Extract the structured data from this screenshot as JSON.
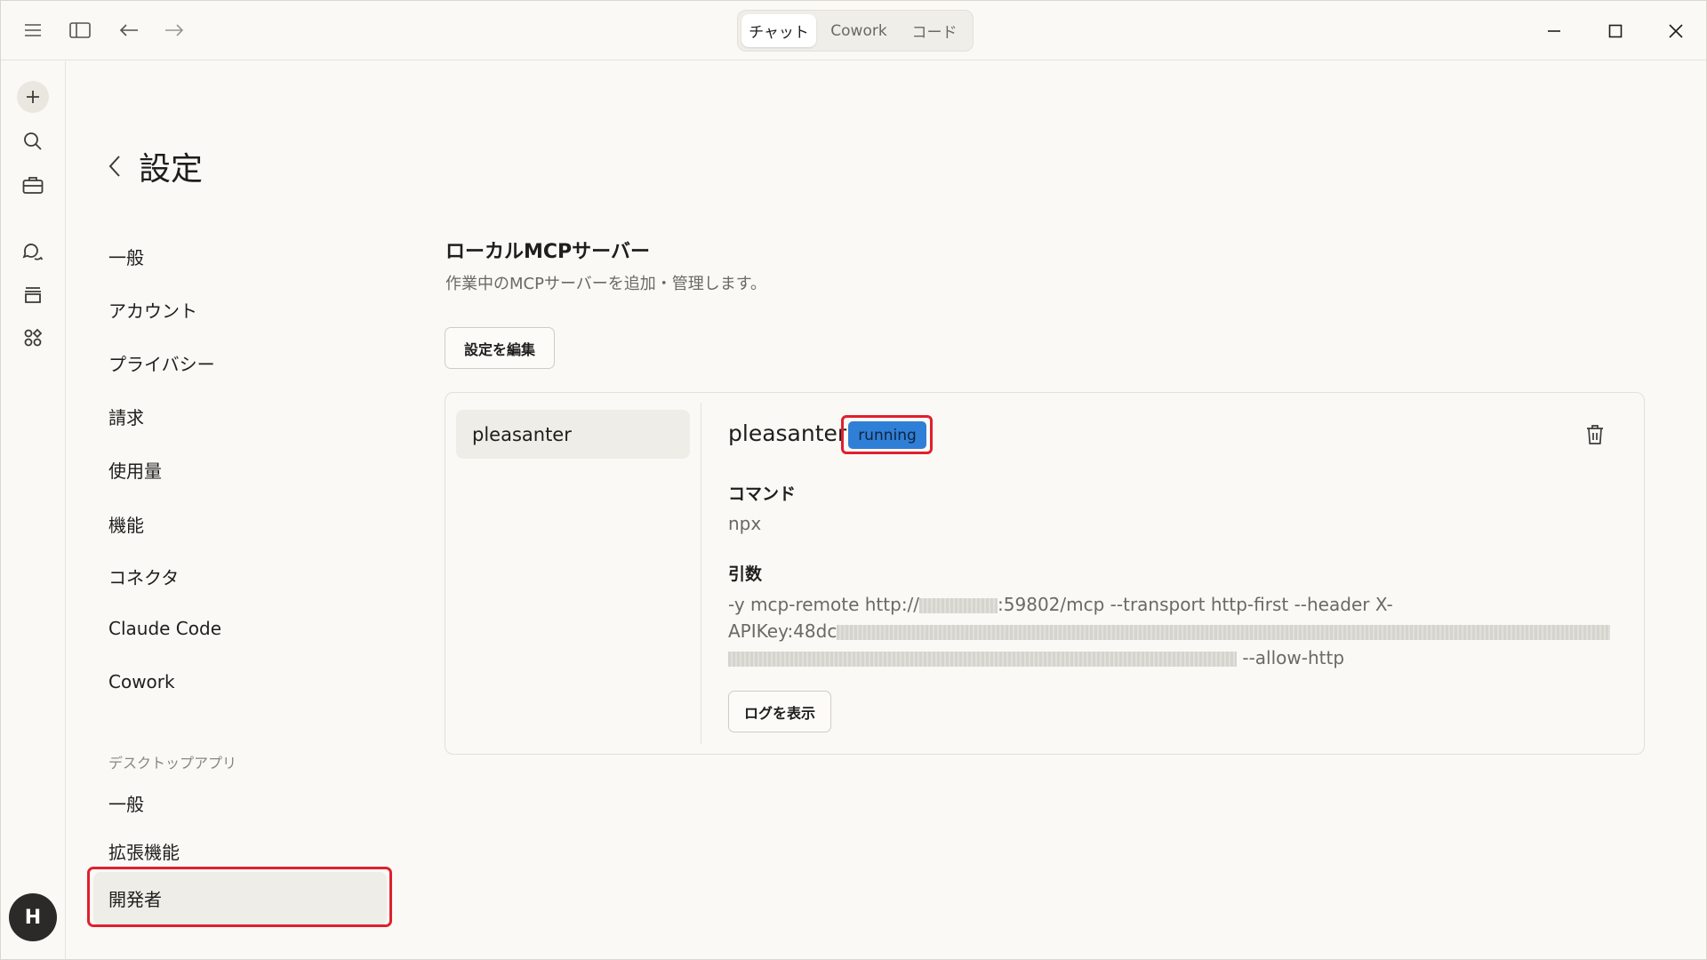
{
  "tabs": [
    {
      "label": "チャット",
      "active": true
    },
    {
      "label": "Cowork",
      "active": false
    },
    {
      "label": "コード",
      "active": false
    }
  ],
  "rail": {
    "icons": [
      "plus-icon",
      "search-icon",
      "toolbox-icon",
      "chat-bubbles-icon",
      "projects-icon",
      "artifacts-icon"
    ],
    "avatar_initial": "H"
  },
  "settings": {
    "title": "設定",
    "nav": [
      "一般",
      "アカウント",
      "プライバシー",
      "請求",
      "使用量",
      "機能",
      "コネクタ",
      "Claude Code",
      "Cowork"
    ],
    "desktop_section": "デスクトップアプリ",
    "desktop_nav": [
      "一般",
      "拡張機能",
      "開発者"
    ],
    "active_item": "開発者"
  },
  "mcp": {
    "title": "ローカルMCPサーバー",
    "description": "作業中のMCPサーバーを追加・管理します。",
    "edit_button": "設定を編集",
    "server_list": [
      "pleasanter"
    ],
    "server": {
      "name": "pleasanter",
      "status": "running",
      "command_label": "コマンド",
      "command": "npx",
      "args_label": "引数",
      "args_part1": "-y mcp-remote http://",
      "args_part2": ":59802/mcp --transport http-first --header X-",
      "args_part3": "APIKey:48dc",
      "args_part4": " --allow-http",
      "logs_button": "ログを表示"
    }
  },
  "colors": {
    "background": "#faf9f5",
    "status_badge": "#2f7fd6",
    "highlight": "#e0202e"
  }
}
